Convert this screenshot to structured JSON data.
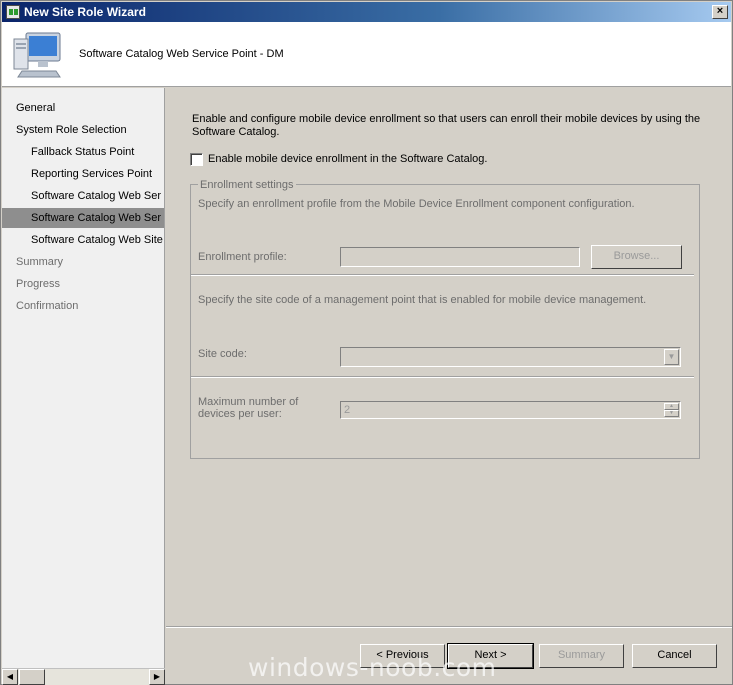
{
  "window": {
    "title": "New Site Role Wizard",
    "close_glyph": "×"
  },
  "header": {
    "title": "Software Catalog Web Service Point - DM"
  },
  "nav": {
    "items": [
      {
        "label": "General",
        "level": "top",
        "state": "normal"
      },
      {
        "label": "System Role Selection",
        "level": "top",
        "state": "normal"
      },
      {
        "label": "Fallback Status Point",
        "level": "sub",
        "state": "normal"
      },
      {
        "label": "Reporting Services Point",
        "level": "sub",
        "state": "normal"
      },
      {
        "label": "Software Catalog Web Ser",
        "level": "sub",
        "state": "normal"
      },
      {
        "label": "Software Catalog Web Ser",
        "level": "sub",
        "state": "selected"
      },
      {
        "label": "Software Catalog Web Site",
        "level": "sub",
        "state": "normal"
      },
      {
        "label": "Summary",
        "level": "top",
        "state": "dim"
      },
      {
        "label": "Progress",
        "level": "top",
        "state": "dim"
      },
      {
        "label": "Confirmation",
        "level": "top",
        "state": "dim"
      }
    ],
    "scroll_left": "◀",
    "scroll_right": "▶"
  },
  "main": {
    "intro": "Enable and configure mobile device enrollment so that users can enroll their mobile devices by using the Software Catalog.",
    "enable_checkbox": {
      "label": "Enable mobile device enrollment in the Software Catalog.",
      "checked": false
    },
    "group": {
      "legend": "Enrollment settings",
      "profile_desc": "Specify an enrollment profile from the Mobile Device Enrollment component configuration.",
      "profile_label": "Enrollment profile:",
      "profile_value": "",
      "browse_label": "Browse...",
      "site_desc": "Specify the site code of a management point that is enabled for mobile device management.",
      "site_label": "Site code:",
      "site_value": "",
      "max_label": "Maximum number of devices per user:",
      "max_value": "2"
    }
  },
  "footer": {
    "previous_label": "< Previous",
    "next_label": "Next >",
    "summary_label": "Summary",
    "cancel_label": "Cancel"
  },
  "watermark": "windows-noob.com"
}
